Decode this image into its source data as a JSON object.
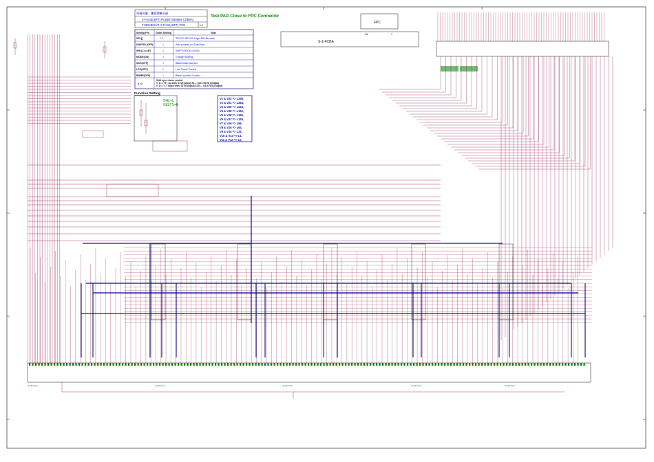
{
  "title_block": {
    "line1": "氘唯光電　專案帶筆三建",
    "line2": "X-Front(LEFT) PCB(NT39366H COB0A)",
    "line3": "T430HB01V0 X-Front(LEFT) PCB",
    "rev": "L4"
  },
  "heading": "Test PAD Close to FPC Connector",
  "fpc": {
    "label": "FPC",
    "part": "S-1-FCBA",
    "pin_left": "N4",
    "pin_right": "1"
  },
  "setting_table": {
    "headers": [
      "Setting Pin",
      "Order Setting",
      "Note"
    ],
    "rows": [
      {
        "pin": "SEL[]",
        "order": "0   0",
        "note": "SELCS=SELC0+High=SELBe=able"
      },
      {
        "pin": "DAVPOL(OFF)",
        "order": "1",
        "note": "Auto polarity on Scan/Auto"
      },
      {
        "pin": "SHL(L===R)",
        "order": "1",
        "note": "SHIFT(OOO)==1000)"
      },
      {
        "pin": "MODE(ON)",
        "order": "1",
        "note": "Charge Sharing"
      },
      {
        "pin": "XDC(OFF)",
        "order": "1",
        "note": "Blank Data Inserted"
      },
      {
        "pin": "LPC(OFF)",
        "order": "1",
        "note": "Low Power Control"
      },
      {
        "pin": "BDMR(OFF)",
        "order": "1",
        "note": "Blank Inserted Control"
      }
    ],
    "v_d_label": "V_D",
    "v_d_notes": [
      "Shift up or down control",
      "V_D = \"H\", up shift, STV0 (Input) S1 -- X273 STVO (Output)",
      "V_D = \"L\", down shift, STVO (Input) X273 -- S1 STVO (Output)"
    ]
  },
  "function_setting": {
    "title": "Function Setting",
    "shl": "SHL=L",
    "selt": "SELT1=H"
  },
  "voltage_map": [
    "V1 & V22 => L255,",
    "V2 & V21 => L254,",
    "V3 & V20 => L224,",
    "V4 & V19 => L192,",
    "V5 & V18 => L160,",
    "V6 & V17 => L128,",
    "V7 & V16 => L96,",
    "V8 & V15 => L64,",
    "V9 & V14 => L32,",
    "V10 & V13 => L1,",
    "V11 & V12 => L0,"
  ],
  "connector_labels": [
    "IN_BLOCK",
    "IN_BLOCK",
    "IN_BLOCK",
    "IN_BLOCK",
    "IN_BLOCK"
  ],
  "colors": {
    "wire": "#8a1040",
    "bus": "#000080",
    "text_blue": "#0000cc",
    "net_green": "#008000",
    "net_red": "#cc0000",
    "frame": "#000000"
  }
}
